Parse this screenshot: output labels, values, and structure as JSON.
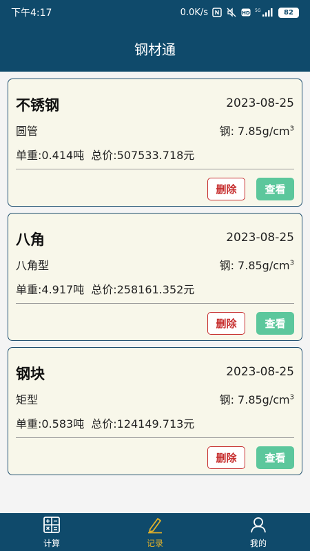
{
  "status_bar": {
    "time": "下午4:17",
    "speed": "0.0K/s",
    "network": "5G",
    "battery": "82"
  },
  "header": {
    "title": "钢材通"
  },
  "records": [
    {
      "name": "不锈钢",
      "date": "2023-08-25",
      "shape": "圆管",
      "density": "钢: 7.85g/cm",
      "density_sup": "3",
      "unit_weight": "单重:0.414吨",
      "total_price": "总价:507533.718元",
      "delete_label": "删除",
      "view_label": "查看"
    },
    {
      "name": "八角",
      "date": "2023-08-25",
      "shape": "八角型",
      "density": "钢: 7.85g/cm",
      "density_sup": "3",
      "unit_weight": "单重:4.917吨",
      "total_price": "总价:258161.352元",
      "delete_label": "删除",
      "view_label": "查看"
    },
    {
      "name": "钢块",
      "date": "2023-08-25",
      "shape": "矩型",
      "density": "钢: 7.85g/cm",
      "density_sup": "3",
      "unit_weight": "单重:0.583吨",
      "total_price": "总价:124149.713元",
      "delete_label": "删除",
      "view_label": "查看"
    }
  ],
  "tabbar": {
    "tabs": [
      {
        "label": "计算",
        "icon": "calculator-icon",
        "active": false
      },
      {
        "label": "记录",
        "icon": "pencil-icon",
        "active": true
      },
      {
        "label": "我的",
        "icon": "user-icon",
        "active": false
      }
    ],
    "active_color": "#e0b02a"
  },
  "colors": {
    "primary": "#0f4a6b",
    "card_bg": "#f8f7ea",
    "delete": "#c62d2d",
    "view": "#5cc79c"
  }
}
